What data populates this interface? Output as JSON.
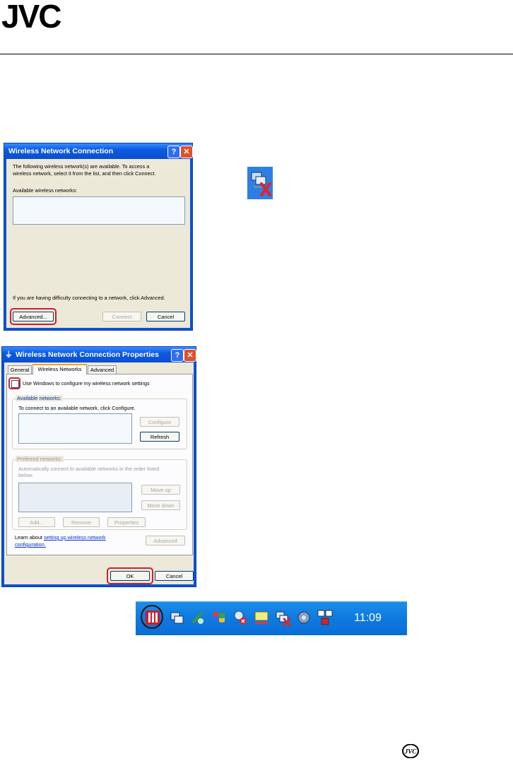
{
  "brand": {
    "logo_text": "JVC",
    "footer_logo_text": "JVC"
  },
  "dialog1": {
    "title": "Wireless Network Connection",
    "help_btn": "?",
    "close_btn": "✕",
    "intro_line1": "The following wireless network(s) are available. To access a",
    "intro_line2": "wireless network, select it from the list, and then click Connect.",
    "available_label": "Available wireless networks:",
    "difficulty_text": "If you are having difficulty connecting to a network, click Advanced.",
    "advanced_btn": "Advanced...",
    "connect_btn": "Connect",
    "cancel_btn": "Cancel"
  },
  "dialog2": {
    "title": "Wireless Network Connection Properties",
    "help_btn": "?",
    "close_btn": "✕",
    "tabs": [
      "General",
      "Wireless Networks",
      "Advanced"
    ],
    "active_tab": "Wireless Networks",
    "use_windows_checkbox": "Use Windows to configure my wireless network settings",
    "available_group": "Available networks:",
    "available_hint": "To connect to an available network, click Configure.",
    "configure_btn": "Configure",
    "refresh_btn": "Refresh",
    "preferred_group": "Preferred networks:",
    "preferred_hint1": "Automatically connect to available networks in the order listed",
    "preferred_hint2": "below:",
    "move_up_btn": "Move up",
    "move_down_btn": "Move down",
    "add_btn": "Add...",
    "remove_btn": "Remove",
    "properties_btn": "Properties",
    "learn_prefix": "Learn about",
    "learn_link1": "setting up wireless network",
    "learn_link2": "configuration.",
    "advanced_btn": "Advanced",
    "ok_btn": "OK",
    "cancel_btn": "Cancel"
  },
  "taskbar": {
    "clock": "11:09",
    "icons": [
      "jvc-utility-icon",
      "network-icon",
      "bluetooth-icon",
      "windows-flag-icon",
      "network-disconnected-icon",
      "monitor-icon",
      "wireless-disconnected-icon",
      "audio-icon",
      "network-shared-icon"
    ]
  },
  "colors": {
    "xp_blue": "#0b52d6",
    "xp_dialog": "#ece9d8",
    "highlight_red": "#d0202a",
    "taskbar_blue": "#0d7ae0"
  }
}
